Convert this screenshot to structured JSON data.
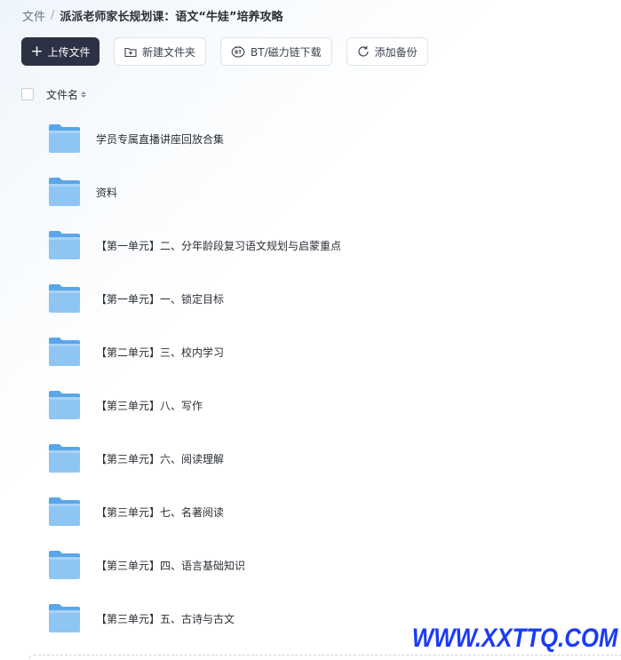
{
  "breadcrumb": {
    "root": "文件",
    "separator": "/",
    "current": "派派老师家长规划课：语文“牛娃”培养攻略"
  },
  "toolbar": {
    "upload_label": "上传文件",
    "new_folder_label": "新建文件夹",
    "bt_download_label": "BT/磁力链下载",
    "add_backup_label": "添加备份"
  },
  "list_header": {
    "name_column": "文件名"
  },
  "files": [
    {
      "name": "学员专属直播讲座回放合集",
      "icon": "folder-icon"
    },
    {
      "name": "资料",
      "icon": "folder-icon"
    },
    {
      "name": "【第一单元】二、分年龄段复习语文规划与启蒙重点",
      "icon": "folder-icon"
    },
    {
      "name": "【第一单元】一、锁定目标",
      "icon": "folder-icon"
    },
    {
      "name": "【第二单元】三、校内学习",
      "icon": "folder-icon"
    },
    {
      "name": "【第三单元】八、写作",
      "icon": "folder-icon"
    },
    {
      "name": "【第三单元】六、阅读理解",
      "icon": "folder-icon"
    },
    {
      "name": "【第三单元】七、名著阅读",
      "icon": "folder-icon"
    },
    {
      "name": "【第三单元】四、语言基础知识",
      "icon": "folder-icon"
    },
    {
      "name": "【第三单元】五、古诗与古文",
      "icon": "folder-icon"
    }
  ],
  "watermark": "WWW.XXTTQ.COM",
  "colors": {
    "primary_button": "#2c3144",
    "folder_front": "#8ec5f3",
    "folder_back": "#5aa6ea",
    "watermark": "#1a3cf5"
  }
}
